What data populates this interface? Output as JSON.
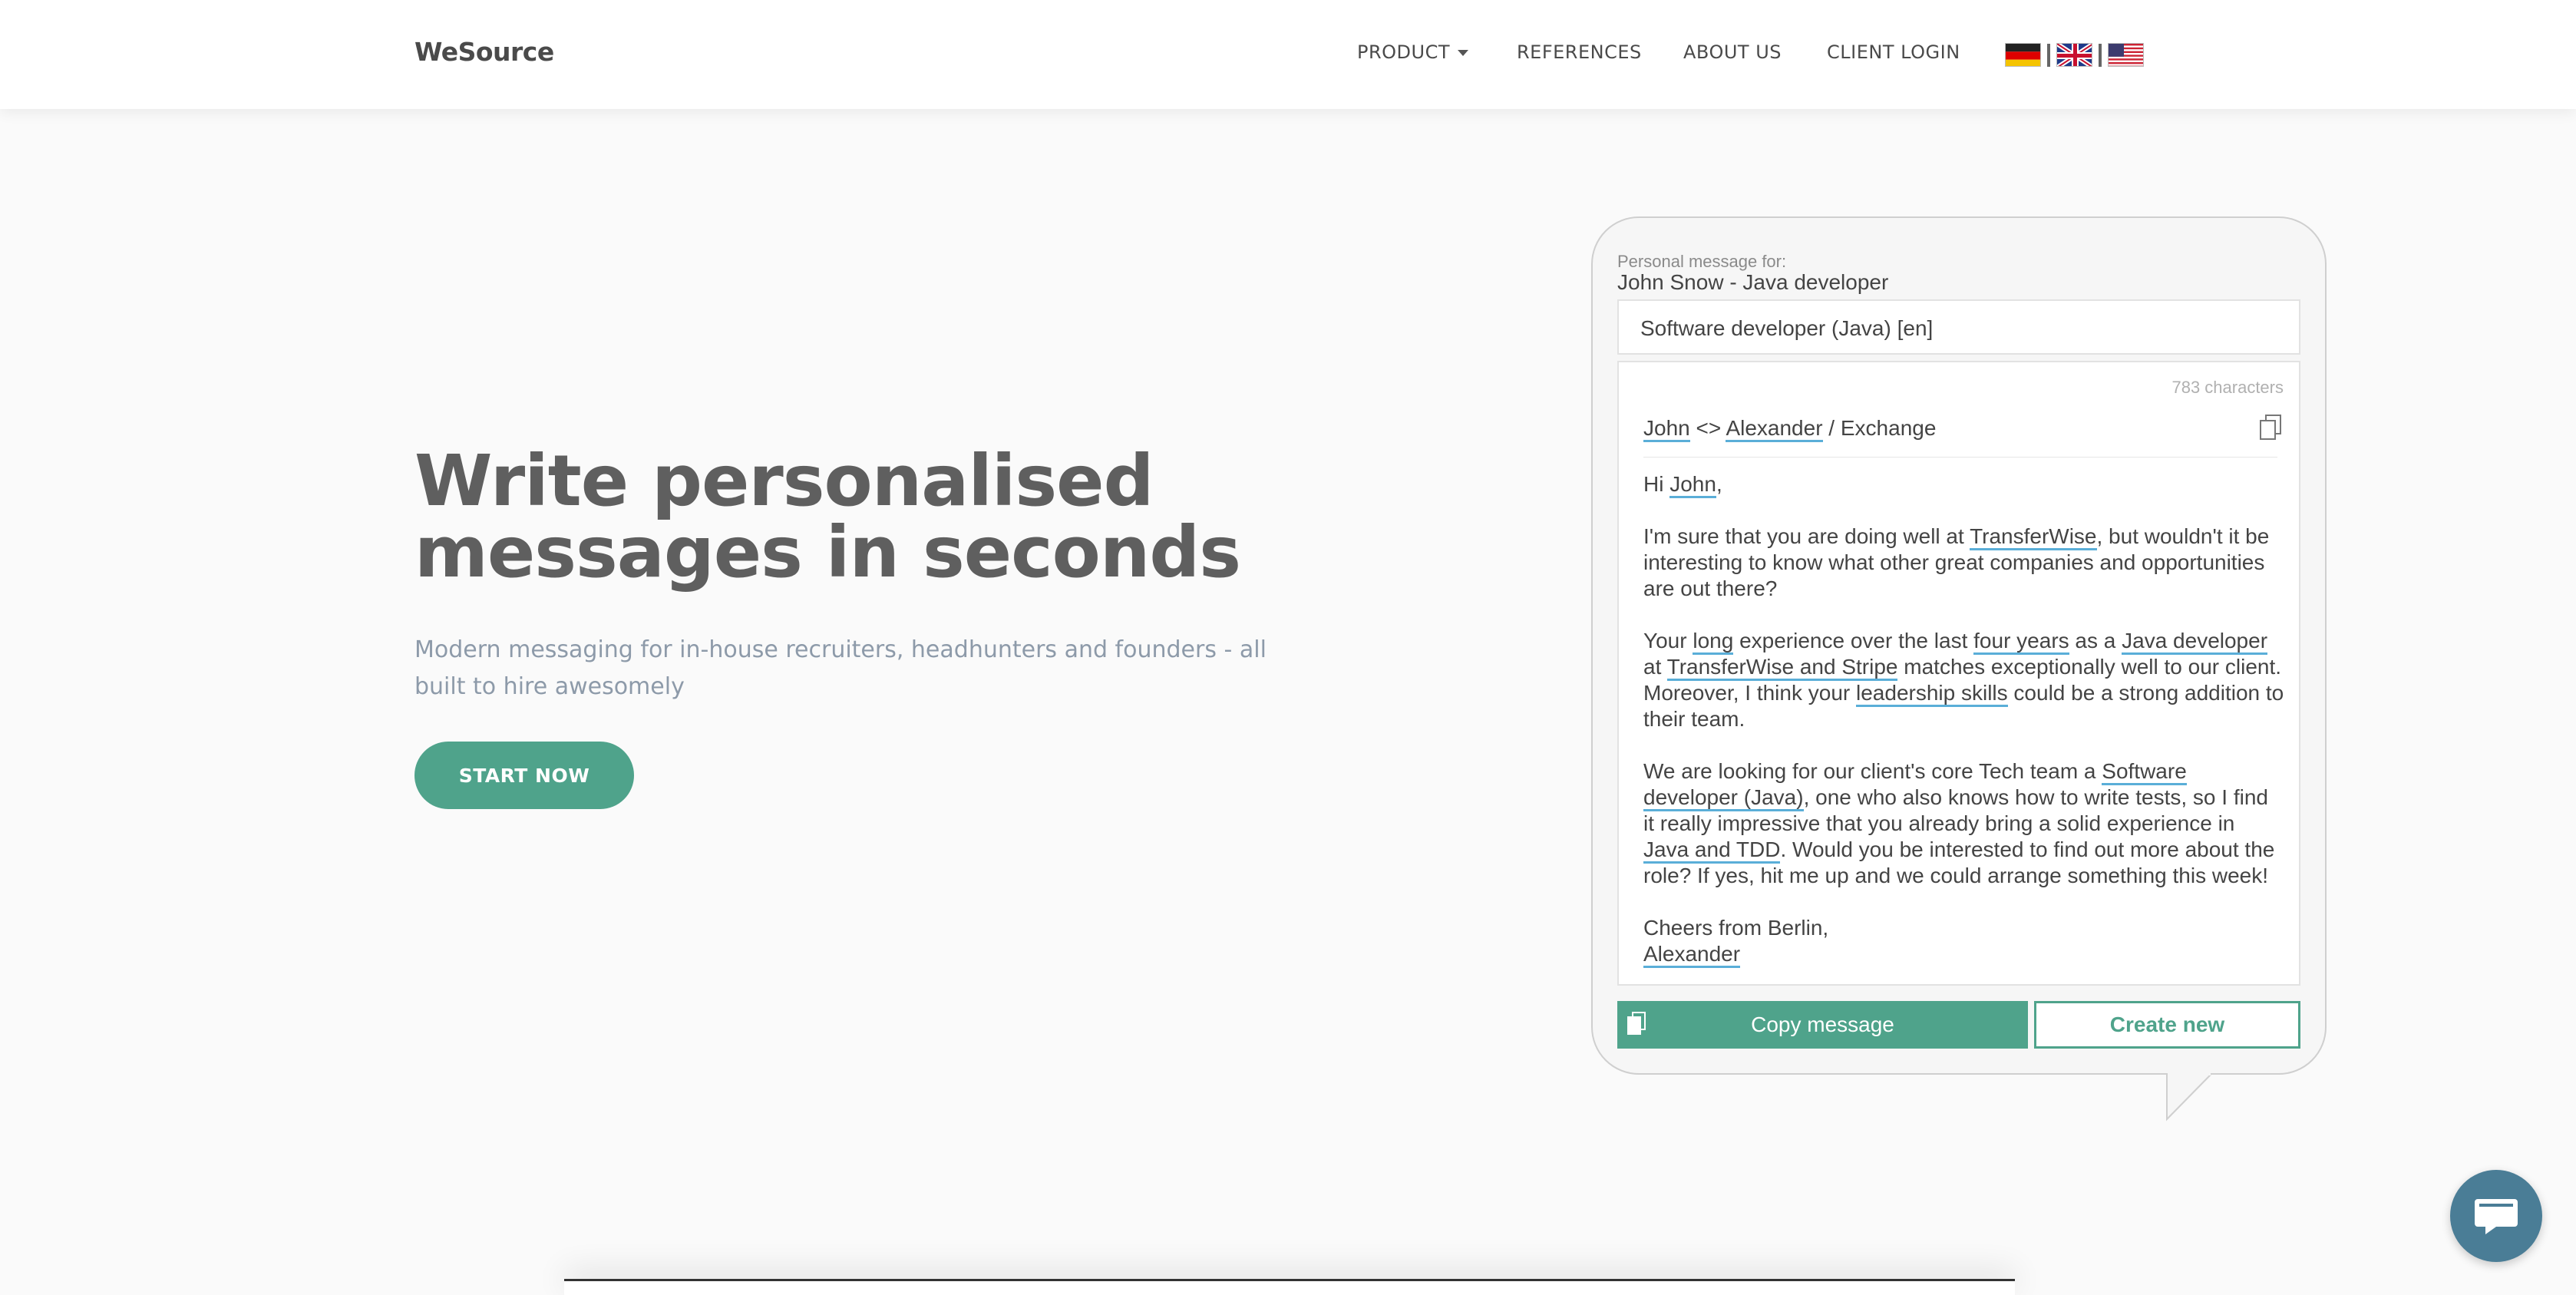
{
  "navbar": {
    "brand": "WeSource",
    "links": [
      "PRODUCT",
      "REFERENCES",
      "ABOUT US",
      "CLIENT LOGIN"
    ],
    "flags": [
      "german-flag-icon",
      "uk-flag-icon",
      "us-flag-icon"
    ],
    "flag_separator": "|"
  },
  "hero": {
    "title_line1": "Write personalised",
    "title_line2": "messages in seconds",
    "subtitle": "Modern messaging for in-house recruiters, headhunters and founders - all built to hire awesomely",
    "cta": "START NOW"
  },
  "card": {
    "label": "Personal message for:",
    "recipient": "John Snow - Java developer",
    "template": "Software developer (Java) [en]",
    "char_count": "783 characters",
    "subject": {
      "name1": "John",
      "sep": " <> ",
      "name2": "Alexander",
      "rest": " / Exchange"
    },
    "greeting": {
      "pre": "Hi ",
      "name": "John",
      "post": ","
    },
    "para1": {
      "a": "I'm sure that you are doing well at ",
      "company": "TransferWise",
      "b": ", but wouldn't it be interesting to know what other great companies and opportunities are out there?"
    },
    "para2": {
      "a": "Your ",
      "long": "long",
      "b": " experience over the last ",
      "years": "four years",
      "c": " as a ",
      "role": "Java developer",
      "d": " at ",
      "companies": "TransferWise and Stripe",
      "e": " matches exceptionally well to our client. Moreover, I think your ",
      "skills": "leadership skills",
      "f": " could be a strong addition to their team."
    },
    "para3": {
      "a": "We are looking for our client's core Tech team a ",
      "position": "Software developer (Java)",
      "b": ", one who also knows how to write tests, so I find it really impressive that you already bring a solid experience in ",
      "tech": "Java and TDD",
      "c": ". Would you be interested to find out more about the role? If yes, hit me up and we could arrange something this week!"
    },
    "signoff": "Cheers from Berlin,",
    "sender": "Alexander",
    "copy_label": "Copy message",
    "create_label": "Create new"
  },
  "colors": {
    "accent": "#4fa38b",
    "highlight_underline": "#5aaed8",
    "chat_button": "#4a7d96"
  }
}
